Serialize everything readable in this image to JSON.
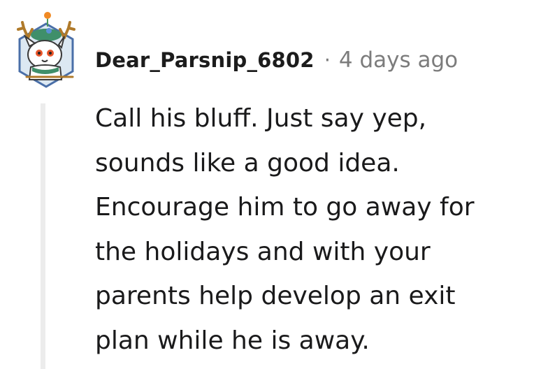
{
  "comment": {
    "author": "Dear_Parsnip_6802",
    "separator": "·",
    "time_ago": "4 days ago",
    "body_lines": [
      "Call his bluff. Just say yep,",
      "sounds like a good idea.",
      "Encourage him to go away for",
      "the holidays and with your",
      "parents help develop an exit",
      "plan while he is away."
    ],
    "avatar_icon": "reindeer-snoo-avatar-icon"
  }
}
